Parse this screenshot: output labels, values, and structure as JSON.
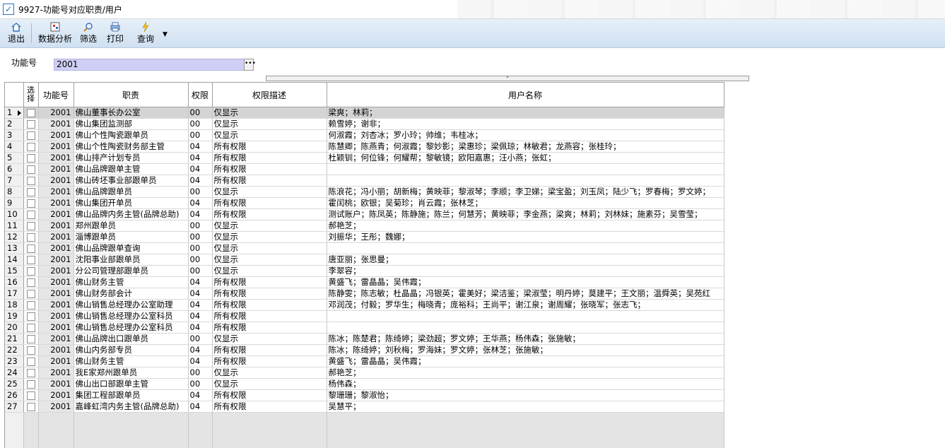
{
  "window": {
    "title": "9927-功能号对应职责/用户"
  },
  "toolbar": {
    "exit": "退出",
    "analysis": "数据分析",
    "filter": "筛选",
    "print": "打印",
    "query": "查询"
  },
  "form": {
    "label": "功能号",
    "value": "2001"
  },
  "table": {
    "headers": {
      "select": "选择",
      "fid": "功能号",
      "duty": "职责",
      "perm": "权限",
      "perm_desc": "权限描述",
      "users": "用户名称"
    },
    "rows": [
      {
        "n": "1",
        "fid": "2001",
        "duty": "佛山董事长办公室",
        "perm": "00",
        "desc": "仅显示",
        "users": "梁爽；林莉；"
      },
      {
        "n": "2",
        "fid": "2001",
        "duty": "佛山集团监测部",
        "perm": "00",
        "desc": "仅显示",
        "users": "赖雪婷；谢非；"
      },
      {
        "n": "3",
        "fid": "2001",
        "duty": "佛山个性陶瓷跟单员",
        "perm": "00",
        "desc": "仅显示",
        "users": "何淑霞；刘杏冰；罗小玲；帅维；韦桂冰；"
      },
      {
        "n": "4",
        "fid": "2001",
        "duty": "佛山个性陶瓷财务部主管",
        "perm": "04",
        "desc": "所有权限",
        "users": "陈慧卿；陈燕青；何淑霞；黎妙影；梁惠珍；梁佩琼；林敏君；龙燕容；张桂玲；"
      },
      {
        "n": "5",
        "fid": "2001",
        "duty": "佛山排产计划专员",
        "perm": "04",
        "desc": "所有权限",
        "users": "杜颖钏；何位锋；何耀帮；黎敏镜；欧阳嘉惠；汪小燕；张虹；"
      },
      {
        "n": "6",
        "fid": "2001",
        "duty": "佛山品牌跟单主管",
        "perm": "04",
        "desc": "所有权限",
        "users": ""
      },
      {
        "n": "7",
        "fid": "2001",
        "duty": "佛山砖坯事业部跟单员",
        "perm": "04",
        "desc": "所有权限",
        "users": ""
      },
      {
        "n": "8",
        "fid": "2001",
        "duty": "佛山品牌跟单员",
        "perm": "00",
        "desc": "仅显示",
        "users": "陈浪花；冯小丽；胡新梅；黄映菲；黎淑琴；李顺；李卫娣；梁宝盈；刘玉凤；陆少飞；罗春梅；罗文婷；"
      },
      {
        "n": "9",
        "fid": "2001",
        "duty": "佛山集团开单员",
        "perm": "04",
        "desc": "所有权限",
        "users": "霍闰桃；欧银；吴菊珍；肖云霞；张林芝；"
      },
      {
        "n": "10",
        "fid": "2001",
        "duty": "佛山品牌内务主管(品牌总助)",
        "perm": "04",
        "desc": "所有权限",
        "users": "测试账户；陈凤英；陈静施；陈兰；何慧芳；黄映菲；李金燕；梁爽；林莉；刘林妹；施素芬；吴雪莹；"
      },
      {
        "n": "11",
        "fid": "2001",
        "duty": "郑州跟单员",
        "perm": "00",
        "desc": "仅显示",
        "users": "郝艳芝；"
      },
      {
        "n": "12",
        "fid": "2001",
        "duty": "淄博跟单员",
        "perm": "00",
        "desc": "仅显示",
        "users": "刘振华；王彤；魏娜；"
      },
      {
        "n": "13",
        "fid": "2001",
        "duty": "佛山品牌跟单查询",
        "perm": "00",
        "desc": "仅显示",
        "users": ""
      },
      {
        "n": "14",
        "fid": "2001",
        "duty": "沈阳事业部跟单员",
        "perm": "00",
        "desc": "仅显示",
        "users": "唐亚丽；张思曼；"
      },
      {
        "n": "15",
        "fid": "2001",
        "duty": "分公司管理部跟单员",
        "perm": "00",
        "desc": "仅显示",
        "users": "李翠容；"
      },
      {
        "n": "16",
        "fid": "2001",
        "duty": "佛山财务主管",
        "perm": "04",
        "desc": "所有权限",
        "users": "黄盛飞；雷晶晶；吴伟霞；"
      },
      {
        "n": "17",
        "fid": "2001",
        "duty": "佛山财务部会计",
        "perm": "04",
        "desc": "所有权限",
        "users": "陈静雯；陈志敏；杜晶晶；冯银英；霍美好；梁洁鉴；梁淑莹；明丹婷；莫建平；王文丽；温舜英；吴苑红"
      },
      {
        "n": "18",
        "fid": "2001",
        "duty": "佛山销售总经理办公室助理",
        "perm": "04",
        "desc": "所有权限",
        "users": "邓润茂；付毅；罗华生；梅晓青；庞裕科；王尚平；谢江泉；谢周耀；张晓军；张志飞；"
      },
      {
        "n": "19",
        "fid": "2001",
        "duty": "佛山销售总经理办公室科员",
        "perm": "04",
        "desc": "所有权限",
        "users": ""
      },
      {
        "n": "20",
        "fid": "2001",
        "duty": "佛山销售总经理办公室科员",
        "perm": "04",
        "desc": "所有权限",
        "users": ""
      },
      {
        "n": "21",
        "fid": "2001",
        "duty": "佛山品牌出口跟单员",
        "perm": "00",
        "desc": "仅显示",
        "users": "陈冰；陈楚君；陈绮婷；梁劲超；罗文婷；王华燕；杨伟森；张施敏；"
      },
      {
        "n": "22",
        "fid": "2001",
        "duty": "佛山内务部专员",
        "perm": "04",
        "desc": "所有权限",
        "users": "陈冰；陈绮婷；刘秋梅；罗海妹；罗文婷；张林芝；张施敏；"
      },
      {
        "n": "23",
        "fid": "2001",
        "duty": "佛山财务主管",
        "perm": "04",
        "desc": "所有权限",
        "users": "黄盛飞；雷晶晶；吴伟霞；"
      },
      {
        "n": "24",
        "fid": "2001",
        "duty": "我E家郑州跟单员",
        "perm": "00",
        "desc": "仅显示",
        "users": "郝艳芝；"
      },
      {
        "n": "25",
        "fid": "2001",
        "duty": "佛山出口部跟单主管",
        "perm": "00",
        "desc": "仅显示",
        "users": "杨伟森；"
      },
      {
        "n": "26",
        "fid": "2001",
        "duty": "集团工程部跟单员",
        "perm": "04",
        "desc": "所有权限",
        "users": "黎珊珊；黎淑怡；"
      },
      {
        "n": "27",
        "fid": "2001",
        "duty": "嘉峰虹湾内务主管(品牌总助)",
        "perm": "04",
        "desc": "所有权限",
        "users": "吴慧平；"
      }
    ]
  }
}
